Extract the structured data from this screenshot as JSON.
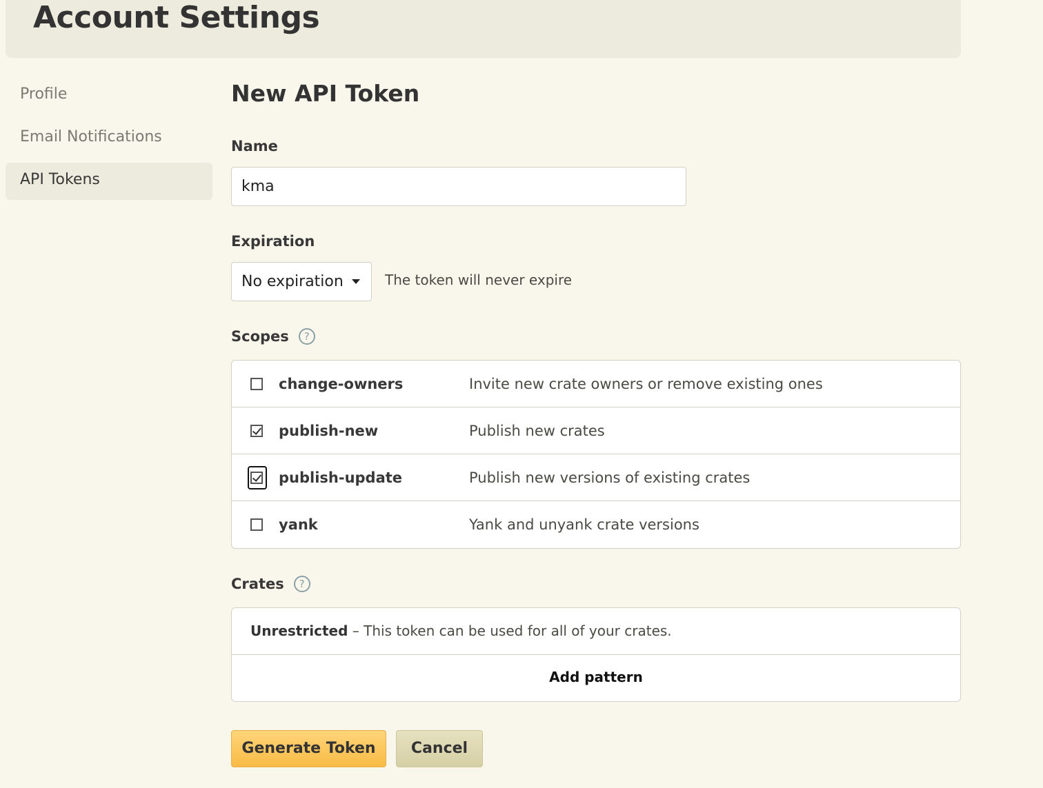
{
  "header": {
    "title": "Account Settings"
  },
  "sidebar": {
    "items": [
      {
        "label": "Profile"
      },
      {
        "label": "Email Notifications"
      },
      {
        "label": "API Tokens"
      }
    ]
  },
  "form": {
    "title": "New API Token",
    "name_label": "Name",
    "name_value": "kma",
    "expiration_label": "Expiration",
    "expiration_value": "No expiration",
    "expiration_note": "The token will never expire",
    "scopes_label": "Scopes",
    "scopes_help": "?",
    "scopes": [
      {
        "name": "change-owners",
        "description": "Invite new crate owners or remove existing ones",
        "checked": false
      },
      {
        "name": "publish-new",
        "description": "Publish new crates",
        "checked": true
      },
      {
        "name": "publish-update",
        "description": "Publish new versions of existing crates",
        "checked": true
      },
      {
        "name": "yank",
        "description": "Yank and unyank crate versions",
        "checked": false
      }
    ],
    "crates_label": "Crates",
    "crates_help": "?",
    "crates_unrestricted": "Unrestricted",
    "crates_note": " – This token can be used for all of your crates.",
    "add_pattern": "Add pattern",
    "generate_label": "Generate Token",
    "cancel_label": "Cancel"
  }
}
